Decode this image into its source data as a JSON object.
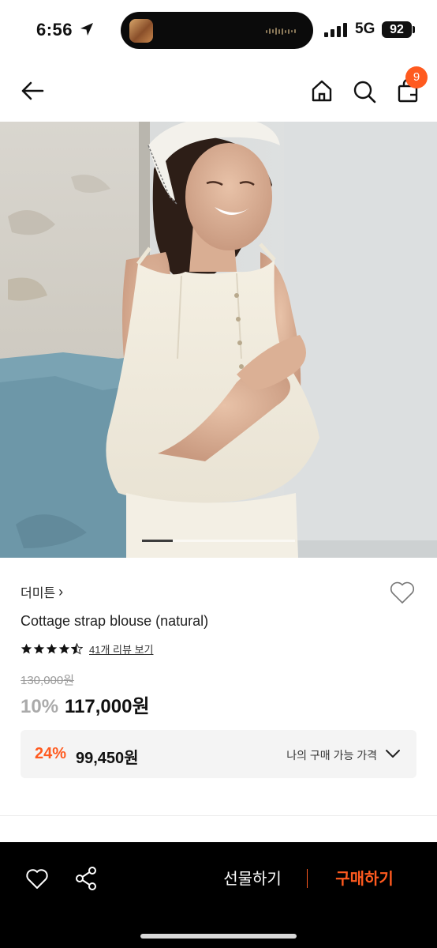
{
  "status_bar": {
    "time": "6:56",
    "network": "5G",
    "battery": "92"
  },
  "nav": {
    "cart_count": "9"
  },
  "product": {
    "brand": "더미튼",
    "brand_chevron": "›",
    "name": "Cottage strap blouse (natural)",
    "rating": 4.5,
    "review_link": "41개 리뷰 보기",
    "original_price": "130,000원",
    "discount": "10%",
    "price": "117,000원"
  },
  "my_price": {
    "discount": "24%",
    "amount": "99,450원",
    "label": "나의 구매 가능 가격"
  },
  "bottom_bar": {
    "gift_label": "선물하기",
    "buy_label": "구매하기"
  },
  "gallery": {
    "current_slide_fraction": 0.2
  },
  "colors": {
    "accent": "#ff5a1f",
    "bottom_bar": "#000000",
    "price_box": "#f4f4f4"
  },
  "icons": [
    "location-arrow-icon",
    "signal-icon",
    "back-arrow-icon",
    "home-icon",
    "search-icon",
    "shopping-bag-icon",
    "heart-icon",
    "share-icon",
    "chevron-down-icon",
    "star-icon"
  ]
}
